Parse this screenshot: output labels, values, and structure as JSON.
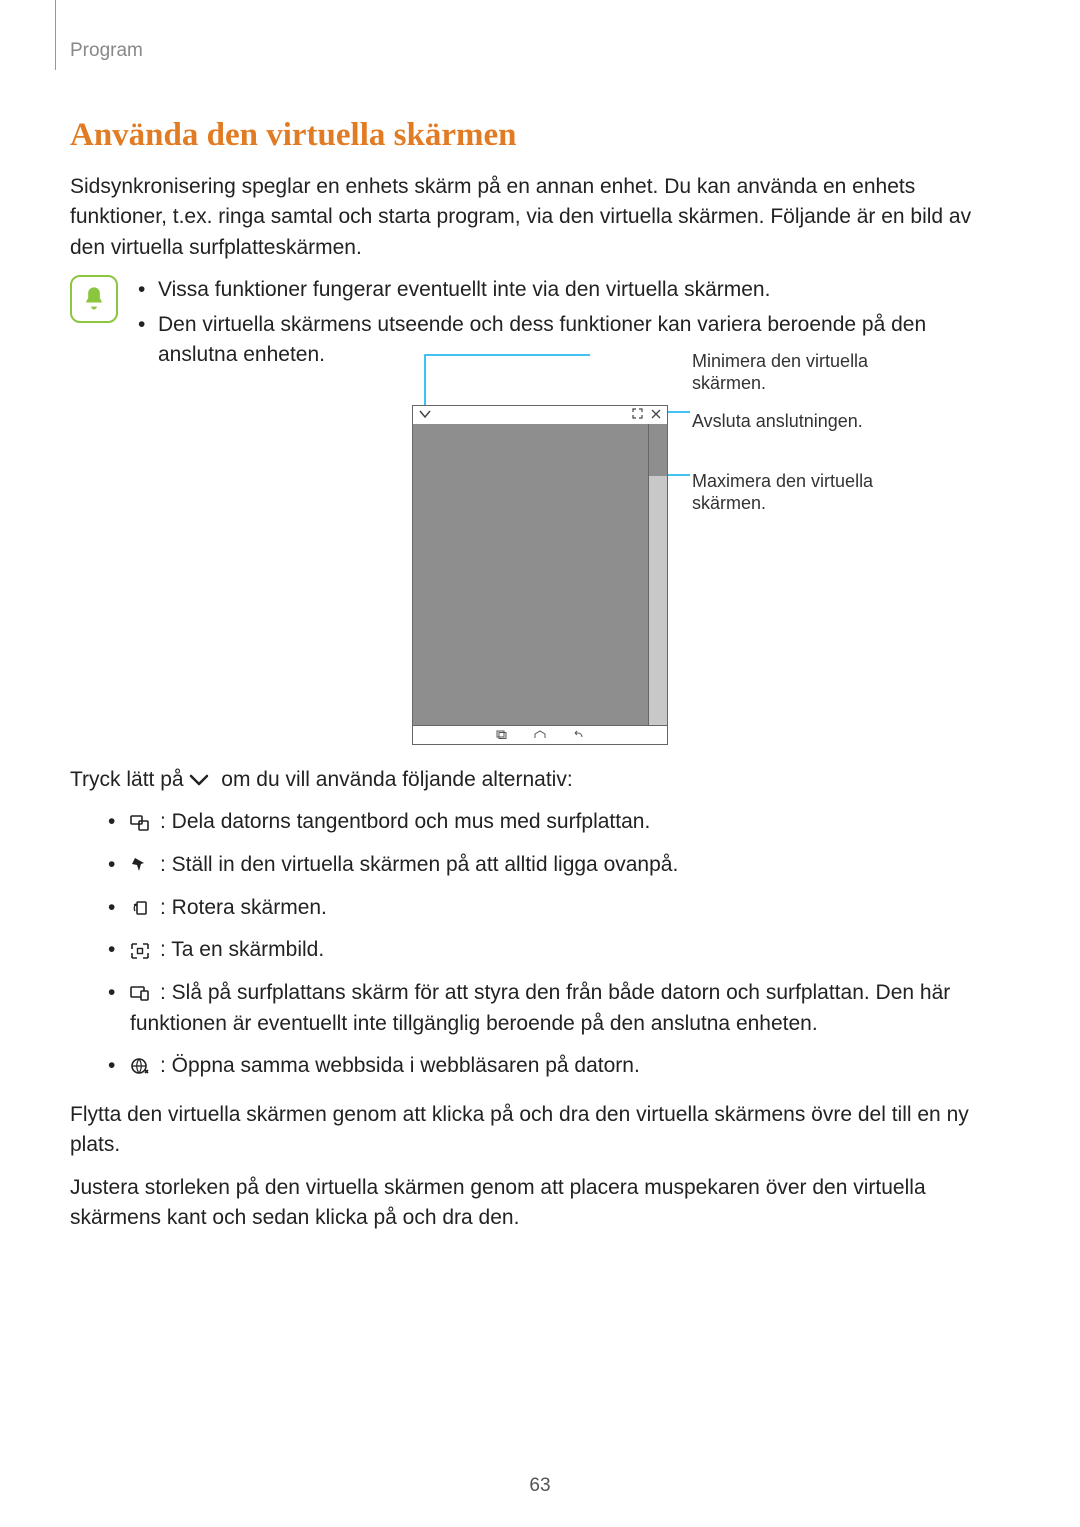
{
  "header": {
    "section": "Program"
  },
  "title": "Använda den virtuella skärmen",
  "intro": "Sidsynkronisering speglar en enhets skärm på en annan enhet. Du kan använda en enhets funktioner, t.ex. ringa samtal och starta program, via den virtuella skärmen. Följande är en bild av den virtuella surfplatteskärmen.",
  "notes": [
    "Vissa funktioner fungerar eventuellt inte via den virtuella skärmen.",
    "Den virtuella skärmens utseende och dess funktioner kan variera beroende på den anslutna enheten."
  ],
  "callouts": {
    "minimize": "Minimera den virtuella skärmen.",
    "close": "Avsluta anslutningen.",
    "maximize": "Maximera den virtuella skärmen."
  },
  "tap_prefix": "Tryck lätt på",
  "tap_suffix": "om du vill använda följande alternativ:",
  "options": [
    ": Dela datorns tangentbord och mus med surfplattan.",
    ": Ställ in den virtuella skärmen på att alltid ligga ovanpå.",
    ": Rotera skärmen.",
    ": Ta en skärmbild.",
    ": Slå på surfplattans skärm för att styra den från både datorn och surfplattan. Den här funktionen är eventuellt inte tillgänglig beroende på den anslutna enheten.",
    ": Öppna samma webbsida i webbläsaren på datorn."
  ],
  "move_text": "Flytta den virtuella skärmen genom att klicka på och dra den virtuella skärmens övre del till en ny plats.",
  "resize_text": "Justera storleken på den virtuella skärmen genom att placera muspekaren över den virtuella skärmens kant och sedan klicka på och dra den.",
  "page_number": "63"
}
